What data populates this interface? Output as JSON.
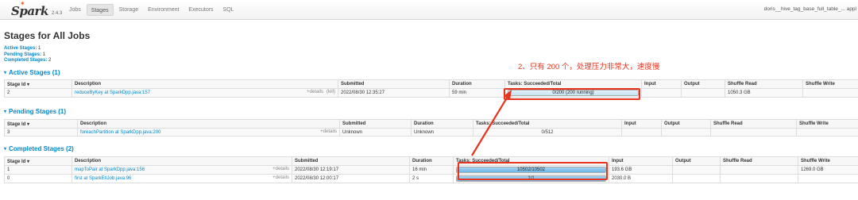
{
  "nav": {
    "brand": "Spark",
    "version": "2.4.3",
    "tabs": [
      {
        "label": "Jobs"
      },
      {
        "label": "Stages"
      },
      {
        "label": "Storage"
      },
      {
        "label": "Environment"
      },
      {
        "label": "Executors"
      },
      {
        "label": "SQL"
      }
    ],
    "active_tab": "Stages",
    "app_name": "doris__hive_tag_base_full_table_... appl"
  },
  "page_title": "Stages for All Jobs",
  "summary": {
    "active": {
      "key": "Active Stages:",
      "value": "1"
    },
    "pending": {
      "key": "Pending Stages:",
      "value": "1"
    },
    "completed": {
      "key": "Completed Stages:",
      "value": "2"
    }
  },
  "annotation": "2、只有 200 个，处理压力非常大，速度慢",
  "active_section": {
    "title": "Active Stages (1)",
    "headers": [
      "Stage Id ▾",
      "Description",
      "Submitted",
      "Duration",
      "Tasks: Succeeded/Total",
      "Input",
      "Output",
      "Shuffle Read",
      "Shuffle Write"
    ],
    "rows": [
      {
        "id": "2",
        "desc": "reduceByKey at SparkDpp.java:157",
        "details": "+details",
        "kill": "(kill)",
        "submitted": "2022/08/30 12:35:27",
        "duration": "59 min",
        "tasks": "0/200 (200 running)",
        "progress": 0,
        "input": "",
        "output": "",
        "shuffle_read": "1050.3 GB",
        "shuffle_write": ""
      }
    ]
  },
  "pending_section": {
    "title": "Pending Stages (1)",
    "headers": [
      "Stage Id ▾",
      "Description",
      "Submitted",
      "Duration",
      "Tasks: Succeeded/Total",
      "Input",
      "Output",
      "Shuffle Read",
      "Shuffle Write"
    ],
    "rows": [
      {
        "id": "3",
        "desc": "foreachPartition at SparkDpp.java:200",
        "details": "+details",
        "submitted": "Unknown",
        "duration": "Unknown",
        "tasks": "0/512",
        "progress": 0,
        "input": "",
        "output": "",
        "shuffle_read": "",
        "shuffle_write": ""
      }
    ]
  },
  "completed_section": {
    "title": "Completed Stages (2)",
    "headers": [
      "Stage Id ▾",
      "Description",
      "Submitted",
      "Duration",
      "Tasks: Succeeded/Total",
      "Input",
      "Output",
      "Shuffle Read",
      "Shuffle Write"
    ],
    "rows": [
      {
        "id": "1",
        "desc": "mapToPair at SparkDpp.java:156",
        "details": "+details",
        "submitted": "2022/08/30 12:19:17",
        "duration": "16 min",
        "tasks": "10502/10502",
        "progress": 1,
        "input": "193.6 GB",
        "output": "",
        "shuffle_read": "",
        "shuffle_write": "1269.0 GB"
      },
      {
        "id": "0",
        "desc": "first at SparkEtlJob.java:96",
        "details": "+details",
        "submitted": "2022/08/30 12:00:17",
        "duration": "2 s",
        "tasks": "1/1",
        "progress": 1,
        "input": "2030.0 B",
        "output": "",
        "shuffle_read": "",
        "shuffle_write": ""
      }
    ]
  },
  "colors": {
    "link": "#0088cc",
    "annotation": "#e8341c",
    "progress_fill": "#6eb6e6"
  }
}
